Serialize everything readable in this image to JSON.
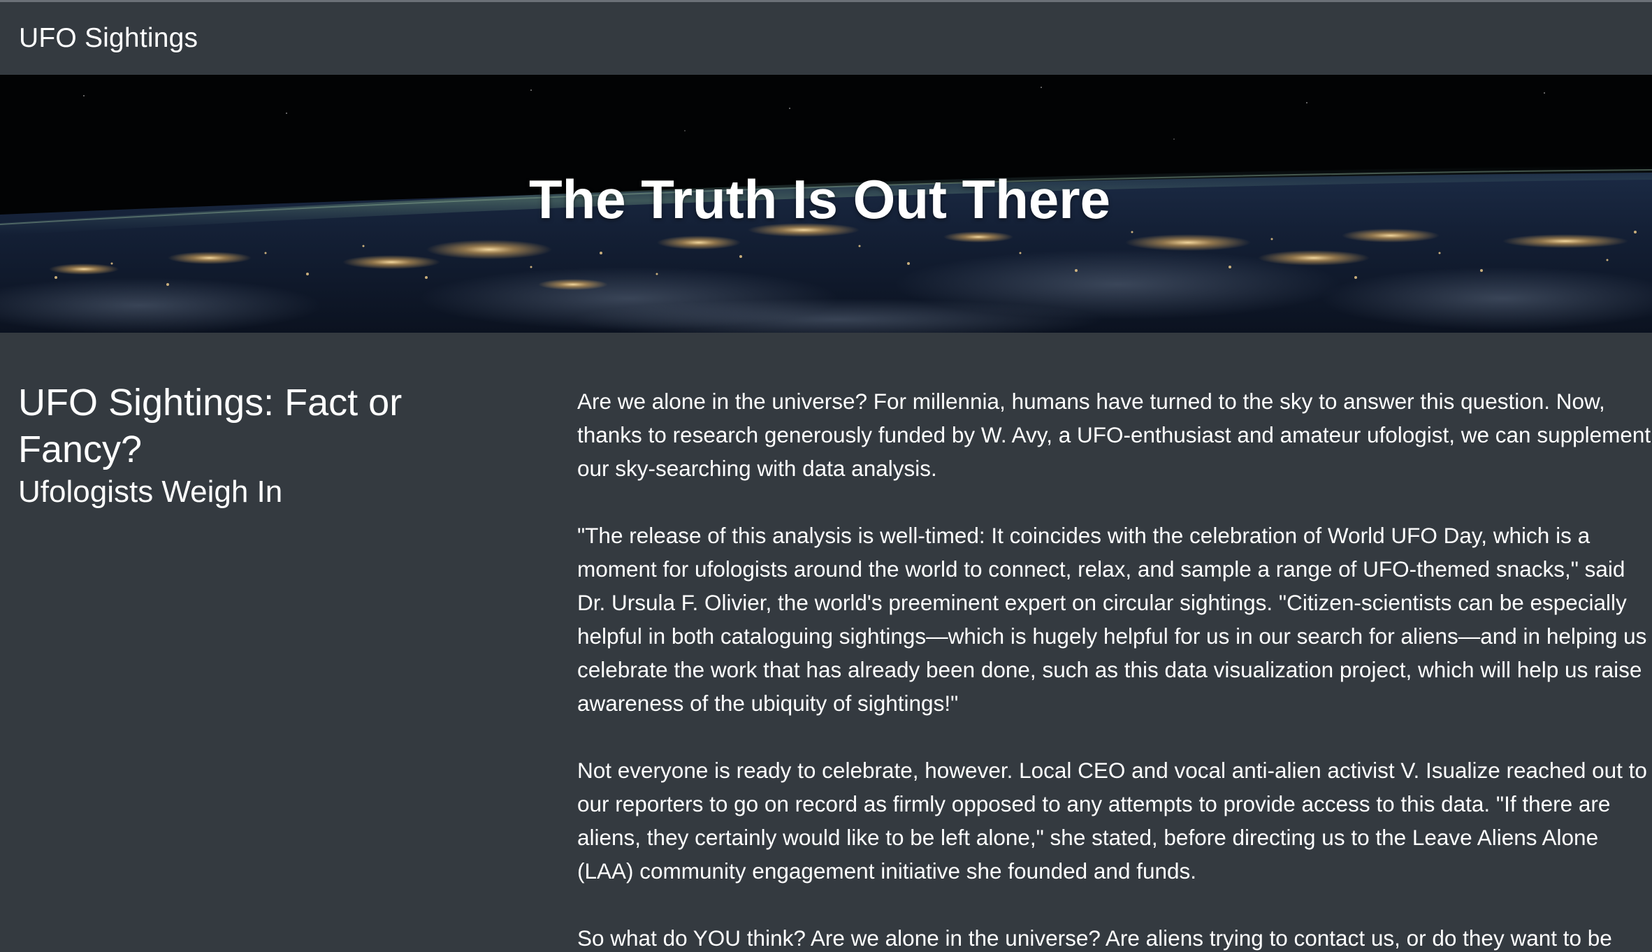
{
  "navbar": {
    "brand": "UFO Sightings"
  },
  "hero": {
    "title": "The Truth Is Out There"
  },
  "article": {
    "headline": "UFO Sightings: Fact or Fancy?",
    "subheadline": "Ufologists Weigh In",
    "paragraphs": [
      "Are we alone in the universe? For millennia, humans have turned to the sky to answer this question. Now, thanks to research generously funded by W. Avy, a UFO-enthusiast and amateur ufologist, we can supplement our sky-searching with data analysis.",
      "\"The release of this analysis is well-timed: It coincides with the celebration of World UFO Day, which is a moment for ufologists around the world to connect, relax, and sample a range of UFO-themed snacks,\" said Dr. Ursula F. Olivier, the world's preeminent expert on circular sightings. \"Citizen-scientists can be especially helpful in both cataloguing sightings—which is hugely helpful for us in our search for aliens—and in helping us celebrate the work that has already been done, such as this data visualization project, which will help us raise awareness of the ubiquity of sightings!\"",
      "Not everyone is ready to celebrate, however. Local CEO and vocal anti-alien activist V. Isualize reached out to our reporters to go on record as firmly opposed to any attempts to provide access to this data. \"If there are aliens, they certainly would like to be left alone,\" she stated, before directing us to the Leave Aliens Alone (LAA) community engagement initiative she founded and funds.",
      "So what do YOU think? Are we alone in the universe? Are aliens trying to contact us, or do they want to be"
    ]
  },
  "colors": {
    "background": "#343a40",
    "text": "#ffffff",
    "hero_sky": "#000000",
    "city_lights": "#f5c77a"
  }
}
